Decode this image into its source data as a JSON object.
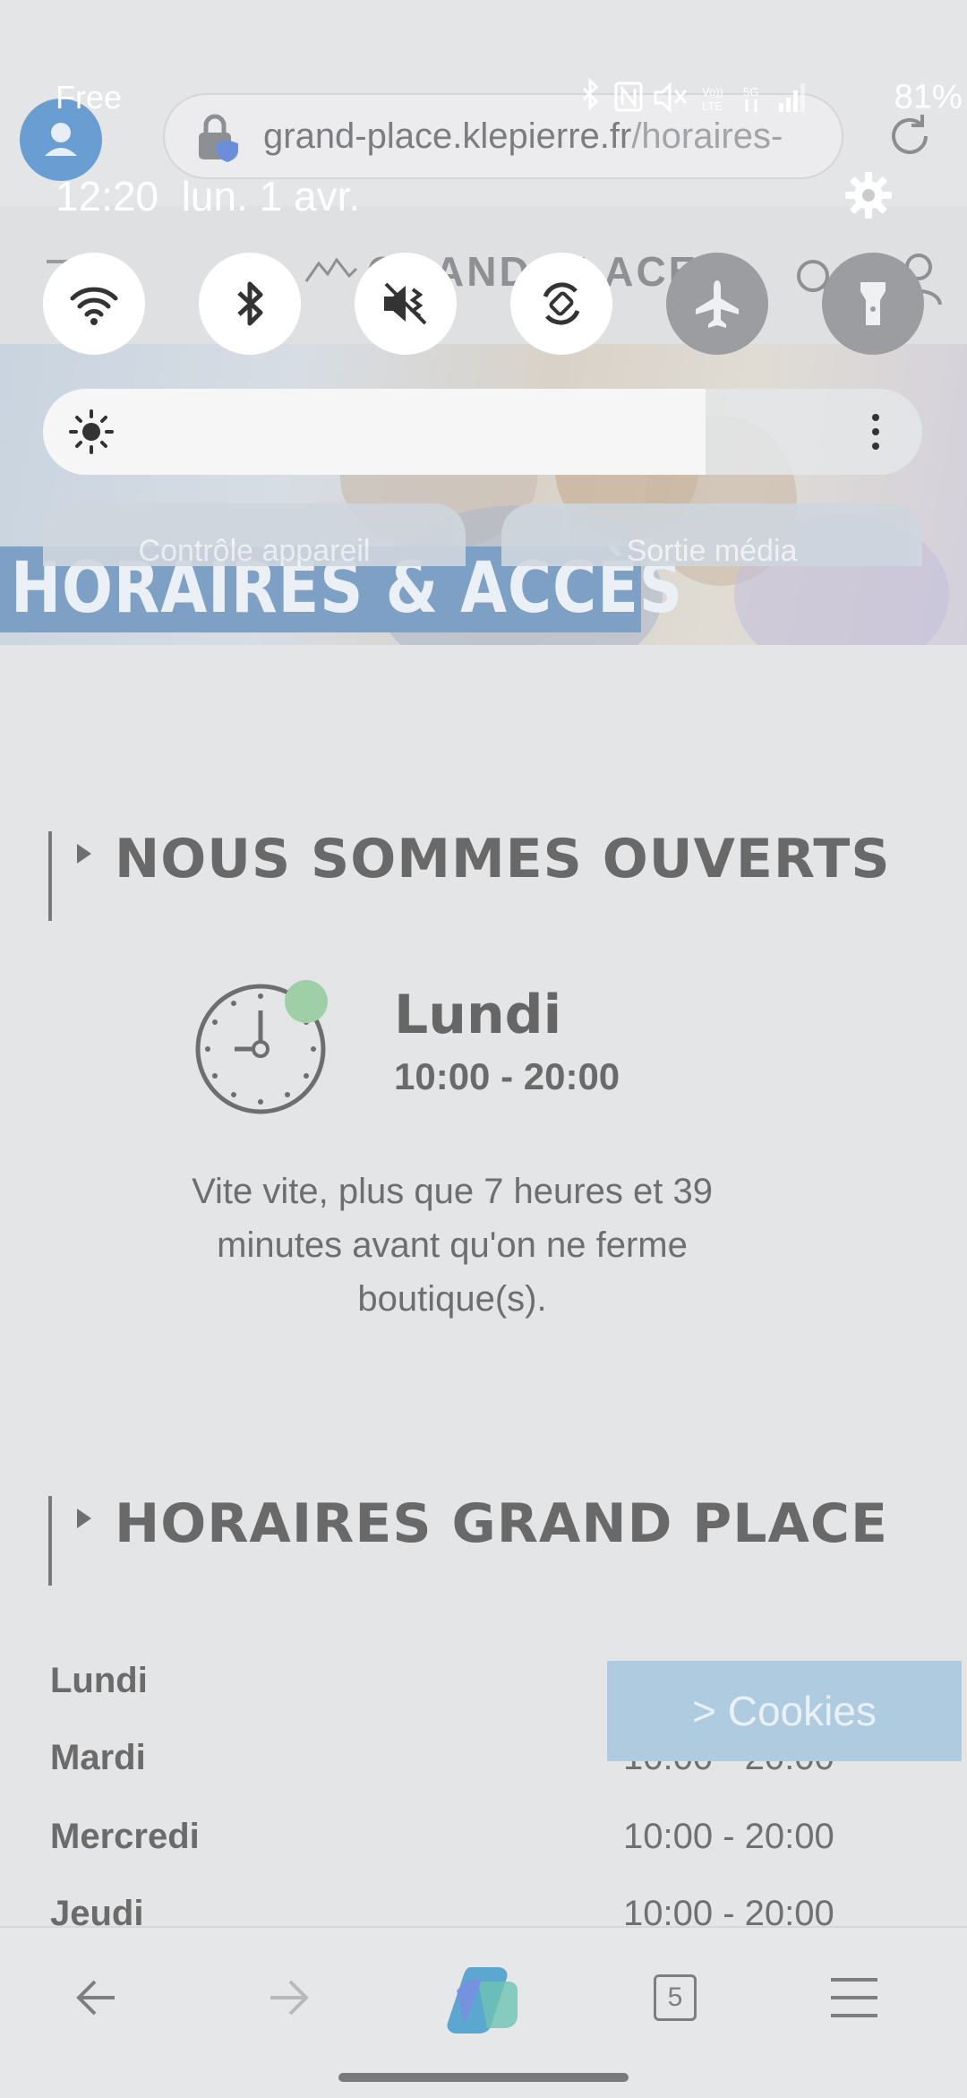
{
  "browser": {
    "url_host": "grand-place.klepierre.fr",
    "url_path": "/horaires-",
    "tab_count": "5"
  },
  "site": {
    "logo": "GRAND PLACE",
    "hero_title": "HORAIRES & ACCÈS",
    "open_section": {
      "title": "NOUS SOMMES OUVERTS",
      "day": "Lundi",
      "hours": "10:00 - 20:00",
      "message": "Vite vite, plus que 7 heures et 39 minutes avant qu'on ne ferme boutique(s)."
    },
    "schedule_section": {
      "title": "HORAIRES GRAND PLACE",
      "rows": [
        {
          "day": "Lundi",
          "hours": ""
        },
        {
          "day": "Mardi",
          "hours": "10:00 - 20:00"
        },
        {
          "day": "Mercredi",
          "hours": "10:00 - 20:00"
        },
        {
          "day": "Jeudi",
          "hours": "10:00 - 20:00"
        }
      ]
    },
    "cookies_label": "> Cookies"
  },
  "shade": {
    "carrier": "Free",
    "battery": "81%",
    "time": "12:20",
    "date": "lun. 1 avr.",
    "toggles": [
      {
        "name": "wifi",
        "state": "on"
      },
      {
        "name": "bluetooth",
        "state": "on"
      },
      {
        "name": "sound-mute",
        "state": "on"
      },
      {
        "name": "auto-rotate",
        "state": "on"
      },
      {
        "name": "airplane",
        "state": "off"
      },
      {
        "name": "flashlight",
        "state": "off"
      }
    ],
    "device_control_label": "Contrôle appareil",
    "media_output_label": "Sortie média"
  },
  "colors": {
    "accent_blue": "#7ea0c4",
    "open_green": "#9fcfa7",
    "cookies_bg": "#aecbe0"
  }
}
